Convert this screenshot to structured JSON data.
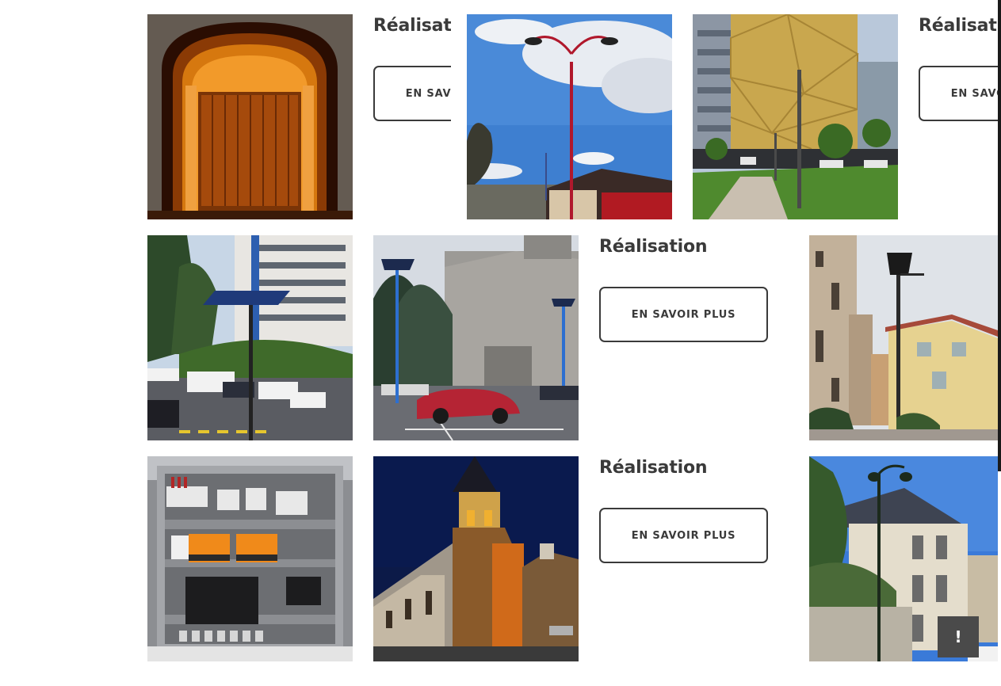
{
  "gallery": {
    "card_title": "Réalisation",
    "card_button": "EN SAVOIR PLUS"
  },
  "feedback": {
    "label": "!"
  },
  "icons": {
    "feedback": "exclamation-icon"
  }
}
